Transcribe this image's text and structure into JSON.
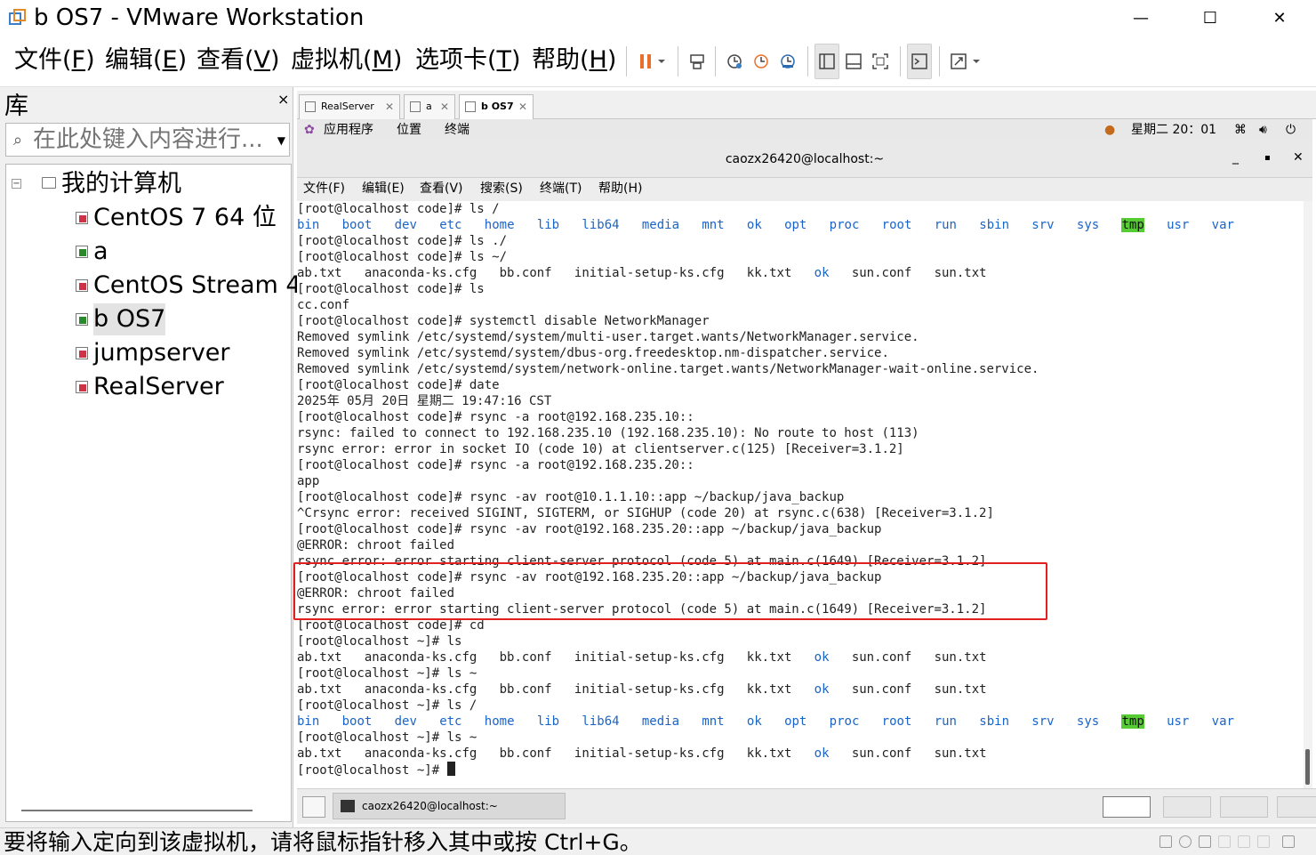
{
  "window": {
    "title": "b OS7 - VMware Workstation",
    "controls": {
      "minimize": "—",
      "maximize": "☐",
      "close": "✕"
    }
  },
  "menubar": {
    "items": [
      {
        "text": "文件(",
        "key": "F",
        "end": ")"
      },
      {
        "text": "编辑(",
        "key": "E",
        "end": ")"
      },
      {
        "text": "查看(",
        "key": "V",
        "end": ")"
      },
      {
        "text": "虚拟机(",
        "key": "M",
        "end": ")"
      },
      {
        "text": "选项卡(",
        "key": "T",
        "end": ")"
      },
      {
        "text": "帮助(",
        "key": "H",
        "end": ")"
      }
    ]
  },
  "toolbar": {
    "icons": [
      "pause-icon",
      "dropdown-arrow-icon",
      "send-ctrl-alt-del-icon",
      "snapshot-take-icon",
      "snapshot-revert-icon",
      "snapshot-manager-icon",
      "show-library-icon",
      "thumbnail-bar-icon",
      "fullscreen-icon",
      "console-view-icon",
      "stretch-guest-icon"
    ],
    "accent": "#e8702a"
  },
  "library": {
    "title": "库",
    "close": "×",
    "search": {
      "placeholder": "在此处键入内容进行..."
    },
    "root": {
      "label": "我的计算机",
      "toggle": "⊟"
    },
    "vms": [
      {
        "label": "CentOS 7 64 位",
        "running": false,
        "selected": false
      },
      {
        "label": "a",
        "running": true,
        "selected": false
      },
      {
        "label": "CentOS Stream 4",
        "running": false,
        "selected": false
      },
      {
        "label": "b OS7",
        "running": true,
        "selected": true
      },
      {
        "label": "jumpserver",
        "running": false,
        "selected": false
      },
      {
        "label": "RealServer",
        "running": false,
        "selected": false
      }
    ]
  },
  "tabs": [
    {
      "label": "RealServer",
      "close": "✕",
      "active": false
    },
    {
      "label": "a",
      "close": "✕",
      "active": false
    },
    {
      "label": "b OS7",
      "close": "✕",
      "active": true
    }
  ],
  "gnome_top": {
    "apps": "应用程序",
    "places": "位置",
    "terminal": "终端",
    "clock": "星期二 20：01"
  },
  "terminal": {
    "title": "caozx26420@localhost:~",
    "controls": {
      "minimize": "_",
      "maximize": "▪",
      "close": "✕"
    },
    "menu": [
      "文件(F)",
      "编辑(E)",
      "查看(V)",
      "搜索(S)",
      "终端(T)",
      "帮助(H)"
    ],
    "lines": [
      "[root@localhost code]# ls /",
      "{dirlist}",
      "[root@localhost code]# ls ./",
      "[root@localhost code]# ls ~/",
      "{homelist}",
      "[root@localhost code]# ls",
      "cc.conf",
      "[root@localhost code]# systemctl disable NetworkManager",
      "Removed symlink /etc/systemd/system/multi-user.target.wants/NetworkManager.service.",
      "Removed symlink /etc/systemd/system/dbus-org.freedesktop.nm-dispatcher.service.",
      "Removed symlink /etc/systemd/system/network-online.target.wants/NetworkManager-wait-online.service.",
      "[root@localhost code]# date",
      "2025年 05月 20日 星期二 19:47:16 CST",
      "[root@localhost code]# rsync -a root@192.168.235.10::",
      "rsync: failed to connect to 192.168.235.10 (192.168.235.10): No route to host (113)",
      "rsync error: error in socket IO (code 10) at clientserver.c(125) [Receiver=3.1.2]",
      "[root@localhost code]# rsync -a root@192.168.235.20::",
      "app",
      "[root@localhost code]# rsync -av root@10.1.1.10::app ~/backup/java_backup",
      "^Crsync error: received SIGINT, SIGTERM, or SIGHUP (code 20) at rsync.c(638) [Receiver=3.1.2]",
      "[root@localhost code]# rsync -av root@192.168.235.20::app ~/backup/java_backup",
      "@ERROR: chroot failed",
      "rsync error: error starting client-server protocol (code 5) at main.c(1649) [Receiver=3.1.2]",
      "[root@localhost code]# rsync -av root@192.168.235.20::app ~/backup/java_backup",
      "@ERROR: chroot failed",
      "rsync error: error starting client-server protocol (code 5) at main.c(1649) [Receiver=3.1.2]",
      "[root@localhost code]# cd",
      "[root@localhost ~]# ls",
      "{homelist}",
      "[root@localhost ~]# ls ~",
      "{homelist}",
      "[root@localhost ~]# ls /",
      "{dirlist}",
      "[root@localhost ~]# ls ~",
      "{homelist}",
      "[root@localhost ~]# "
    ],
    "dirlist": [
      "bin",
      "boot",
      "dev",
      "etc",
      "home",
      "lib",
      "lib64",
      "media",
      "mnt",
      "ok",
      "opt",
      "proc",
      "root",
      "run",
      "sbin",
      "srv",
      "sys",
      "tmp",
      "usr",
      "var"
    ],
    "homelist": [
      "ab.txt",
      "anaconda-ks.cfg",
      "bb.conf",
      "initial-setup-ks.cfg",
      "kk.txt",
      "ok",
      "sun.conf",
      "sun.txt"
    ],
    "dir_color": "#1a64c8",
    "tmp_bg": "#55cc33",
    "highlight_color": "#e12020"
  },
  "gnome_bottom": {
    "task_label": "caozx26420@localhost:~"
  },
  "statusbar": {
    "hint": "要将输入定向到该虚拟机，请将鼠标指针移入其中或按 Ctrl+G。"
  }
}
